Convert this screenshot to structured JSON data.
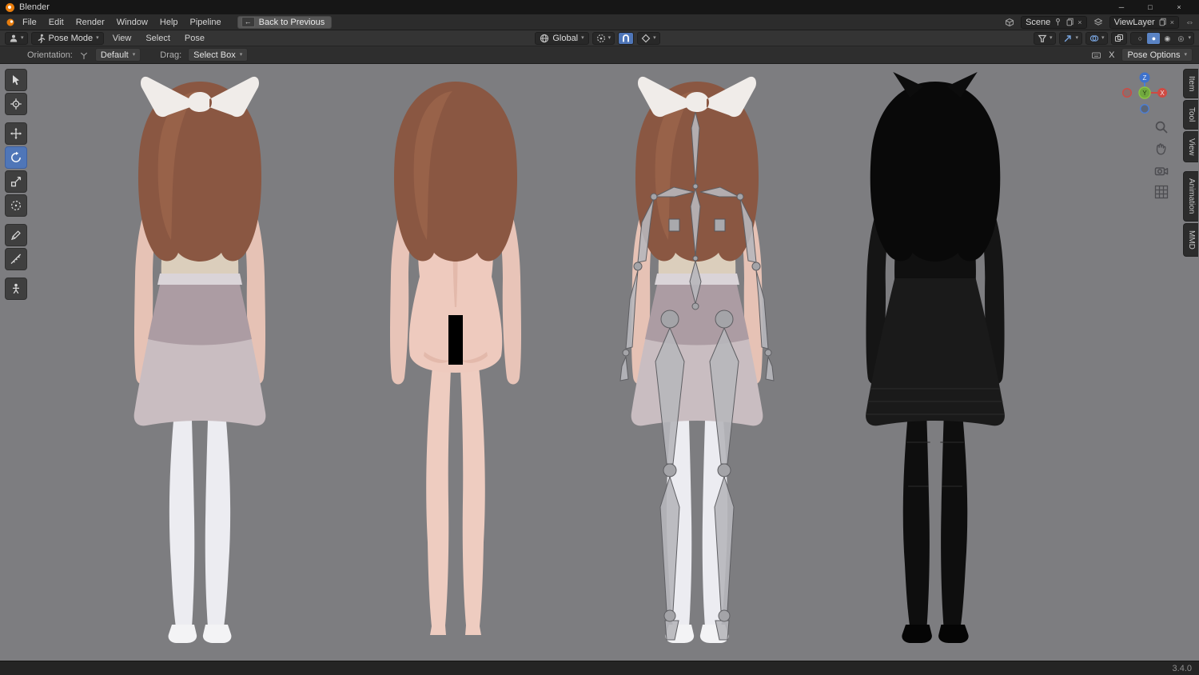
{
  "window": {
    "title": "Blender"
  },
  "titlebar": {
    "minimize": "─",
    "maximize": "□",
    "close": "×"
  },
  "icons": {
    "chevron": "▾",
    "back_arrow": "←",
    "expand": "⇔",
    "close_small": "×",
    "shading_wire": "○",
    "shading_solid": "●",
    "shading_material": "◉",
    "shading_rendered": "◎"
  },
  "menubar": {
    "menus": [
      "File",
      "Edit",
      "Render",
      "Window",
      "Help",
      "Pipeline"
    ],
    "back_button": "Back to Previous",
    "scene_selector": {
      "label": "Scene"
    },
    "viewlayer_selector": {
      "label": "ViewLayer"
    }
  },
  "viewport_header": {
    "mode_selector": "Pose Mode",
    "menus": [
      "View",
      "Select",
      "Pose"
    ],
    "transform_orientation": "Global"
  },
  "tool_settings": {
    "orientation_label": "Orientation:",
    "orientation_value": "Default",
    "drag_label": "Drag:",
    "drag_value": "Select Box",
    "shortcut_key": "X",
    "pose_options_label": "Pose Options"
  },
  "left_toolbar": {
    "tools": [
      "select-box",
      "cursor",
      "move",
      "rotate",
      "scale",
      "transform",
      "annotate",
      "measure",
      "pose-breakdowner"
    ],
    "active_tool": "rotate"
  },
  "nav_gizmo": {
    "x": "X",
    "y": "Y",
    "z": "Z"
  },
  "sidebar_tabs": [
    "Item",
    "Tool",
    "View",
    "Animation",
    "MMD"
  ],
  "viewport": {
    "background": "#7d7d80",
    "models": [
      {
        "name": "clothed-back-view"
      },
      {
        "name": "body-back-view"
      },
      {
        "name": "armature-pose-view"
      },
      {
        "name": "wireframe-view"
      }
    ]
  },
  "colors": {
    "accent_blue": "#4f76b8",
    "axis_x": "#cf4a43",
    "axis_y": "#71a83f",
    "axis_z": "#3e72cc"
  },
  "statusbar": {
    "version": "3.4.0"
  }
}
